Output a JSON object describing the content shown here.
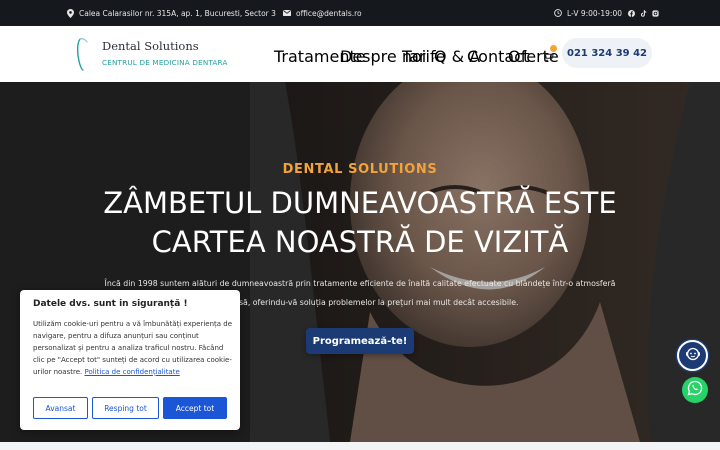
{
  "topbar": {
    "address": "Calea Calarasilor nr. 315A, ap. 1, Bucuresti, Sector 3",
    "email": "office@dentals.ro",
    "hours": "L-V 9:00-19:00",
    "social": [
      "facebook-icon",
      "tiktok-icon",
      "instagram-icon"
    ]
  },
  "header": {
    "logo_name": "Dental Solutions",
    "logo_sub": "CENTRUL DE MEDICINA DENTARA",
    "nav": [
      {
        "label": "Tratamente",
        "has_dropdown": true
      },
      {
        "label": "Despre noi",
        "has_dropdown": true
      },
      {
        "label": "Tarife",
        "has_dropdown": false
      },
      {
        "label": "Q & A",
        "has_dropdown": false
      },
      {
        "label": "Contact",
        "has_dropdown": false
      },
      {
        "label": "Oferte",
        "has_dropdown": false
      }
    ],
    "phone": "021 324 39 42"
  },
  "hero": {
    "eyebrow": "DENTAL SOLUTIONS",
    "headline": "ZÂMBETUL DUMNEAVOASTRĂ ESTE CARTEA NOASTRĂ DE VIZITĂ",
    "lead": "Încă din 1998 suntem alături de dumneavoastră prin tratamente eficiente de înaltă calitate efectuate cu blândețe într-o atmosferă prietenoasă, oferindu-vă soluția problemelor la prețuri mai mult decât accesibile.",
    "cta": "Programează-te!"
  },
  "cookie": {
    "title": "Datele dvs. sunt in siguranță !",
    "text": "Utilizăm cookie-uri pentru a vă îmbunătăți experiența de navigare, pentru a difuza anunțuri sau conținut personalizat și pentru a analiza traficul nostru. Făcând clic pe \"Accept tot\" sunteți de acord cu utilizarea cookie-urilor noastre.",
    "link": "Politica de confidențialitate",
    "buttons": {
      "customize": "Avansat",
      "reject": "Resping tot",
      "accept": "Accept tot"
    }
  },
  "colors": {
    "accent": "#f2a33a",
    "brand": "#1c3a73",
    "teal": "#24a0a0",
    "cookie_blue": "#1a56d6"
  }
}
